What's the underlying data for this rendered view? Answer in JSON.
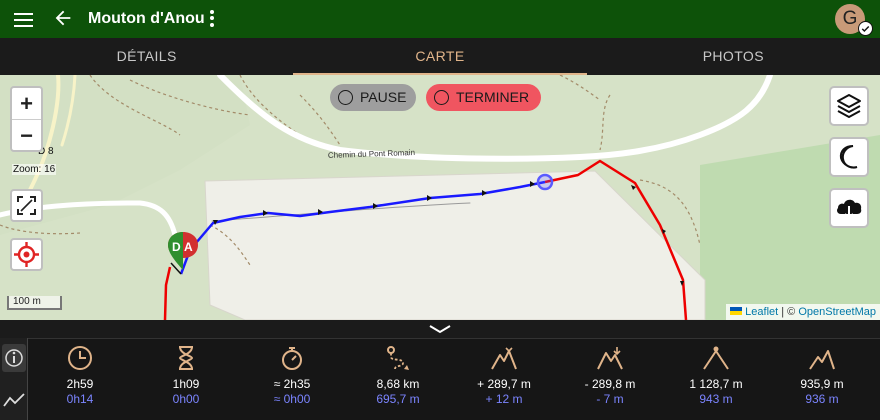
{
  "header": {
    "title": "Mouton d'Anou",
    "avatar_initial": "G"
  },
  "tabs": [
    {
      "label": "DÉTAILS",
      "active": false
    },
    {
      "label": "CARTE",
      "active": true
    },
    {
      "label": "PHOTOS",
      "active": false
    }
  ],
  "map": {
    "zoom_in": "+",
    "zoom_out": "−",
    "zoom_label": "Zoom: 16",
    "road_label": "D 8",
    "street_label": "Chemin du Pont Romain",
    "scale_label": "100 m",
    "pause_label": "PAUSE",
    "stop_label": "TERMINER",
    "marker_start": "D",
    "marker_end": "A",
    "attribution": {
      "leaflet": "Leaflet",
      "separator": "| ©",
      "osm": "OpenStreetMap"
    },
    "colors": {
      "track_recorded": "#1a1aff",
      "track_planned": "#ee0000",
      "background": "#d6e2c7"
    }
  },
  "stats": [
    {
      "icon": "clock-icon",
      "primary": "2h59",
      "secondary": "0h14"
    },
    {
      "icon": "hourglass-icon",
      "primary": "1h09",
      "secondary": "0h00"
    },
    {
      "icon": "stopwatch-icon",
      "primary": "≈ 2h35",
      "secondary": "≈ 0h00"
    },
    {
      "icon": "route-icon",
      "primary": "8,68 km",
      "secondary": "695,7 m"
    },
    {
      "icon": "elevation-gain-icon",
      "primary": "+ 289,7 m",
      "secondary": "+ 12 m"
    },
    {
      "icon": "elevation-loss-icon",
      "primary": "- 289,8 m",
      "secondary": "- 7 m"
    },
    {
      "icon": "max-altitude-icon",
      "primary": "1 128,7 m",
      "secondary": "943 m"
    },
    {
      "icon": "altitude-icon",
      "primary": "935,9 m",
      "secondary": "936 m"
    }
  ]
}
